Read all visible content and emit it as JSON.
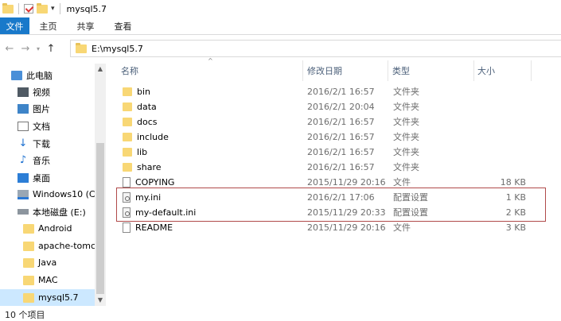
{
  "window": {
    "title": "mysql5.7"
  },
  "ribbon": {
    "tabs": [
      "文件",
      "主页",
      "共享",
      "查看"
    ]
  },
  "address": {
    "path": "E:\\mysql5.7"
  },
  "sidebar": {
    "items": [
      {
        "label": "此电脑",
        "icon": "pc-icon"
      },
      {
        "label": "视频",
        "icon": "video-icon"
      },
      {
        "label": "图片",
        "icon": "picture-icon"
      },
      {
        "label": "文档",
        "icon": "document-icon"
      },
      {
        "label": "下载",
        "icon": "download-icon"
      },
      {
        "label": "音乐",
        "icon": "music-icon"
      },
      {
        "label": "桌面",
        "icon": "desktop-icon"
      },
      {
        "label": "Windows10 (C:",
        "icon": "windows-drive-icon"
      },
      {
        "label": "本地磁盘 (E:)",
        "icon": "disk-icon"
      },
      {
        "label": "Android",
        "icon": "folder-icon"
      },
      {
        "label": "apache-tomca",
        "icon": "folder-icon"
      },
      {
        "label": "Java",
        "icon": "folder-icon"
      },
      {
        "label": "MAC",
        "icon": "folder-icon"
      },
      {
        "label": "mysql5.7",
        "icon": "folder-icon"
      }
    ]
  },
  "columns": {
    "name": "名称",
    "date": "修改日期",
    "type": "类型",
    "size": "大小"
  },
  "files": [
    {
      "name": "bin",
      "date": "2016/2/1 16:57",
      "type": "文件夹",
      "size": "",
      "icon": "folder-icon"
    },
    {
      "name": "data",
      "date": "2016/2/1 20:04",
      "type": "文件夹",
      "size": "",
      "icon": "folder-icon"
    },
    {
      "name": "docs",
      "date": "2016/2/1 16:57",
      "type": "文件夹",
      "size": "",
      "icon": "folder-icon"
    },
    {
      "name": "include",
      "date": "2016/2/1 16:57",
      "type": "文件夹",
      "size": "",
      "icon": "folder-icon"
    },
    {
      "name": "lib",
      "date": "2016/2/1 16:57",
      "type": "文件夹",
      "size": "",
      "icon": "folder-icon"
    },
    {
      "name": "share",
      "date": "2016/2/1 16:57",
      "type": "文件夹",
      "size": "",
      "icon": "folder-icon"
    },
    {
      "name": "COPYING",
      "date": "2015/11/29 20:16",
      "type": "文件",
      "size": "18 KB",
      "icon": "file-icon"
    },
    {
      "name": "my.ini",
      "date": "2016/2/1 17:06",
      "type": "配置设置",
      "size": "1 KB",
      "icon": "ini-file-icon"
    },
    {
      "name": "my-default.ini",
      "date": "2015/11/29 20:33",
      "type": "配置设置",
      "size": "2 KB",
      "icon": "ini-file-icon"
    },
    {
      "name": "README",
      "date": "2015/11/29 20:16",
      "type": "文件",
      "size": "3 KB",
      "icon": "file-icon"
    }
  ],
  "status": {
    "item_count": "10 个项目"
  }
}
